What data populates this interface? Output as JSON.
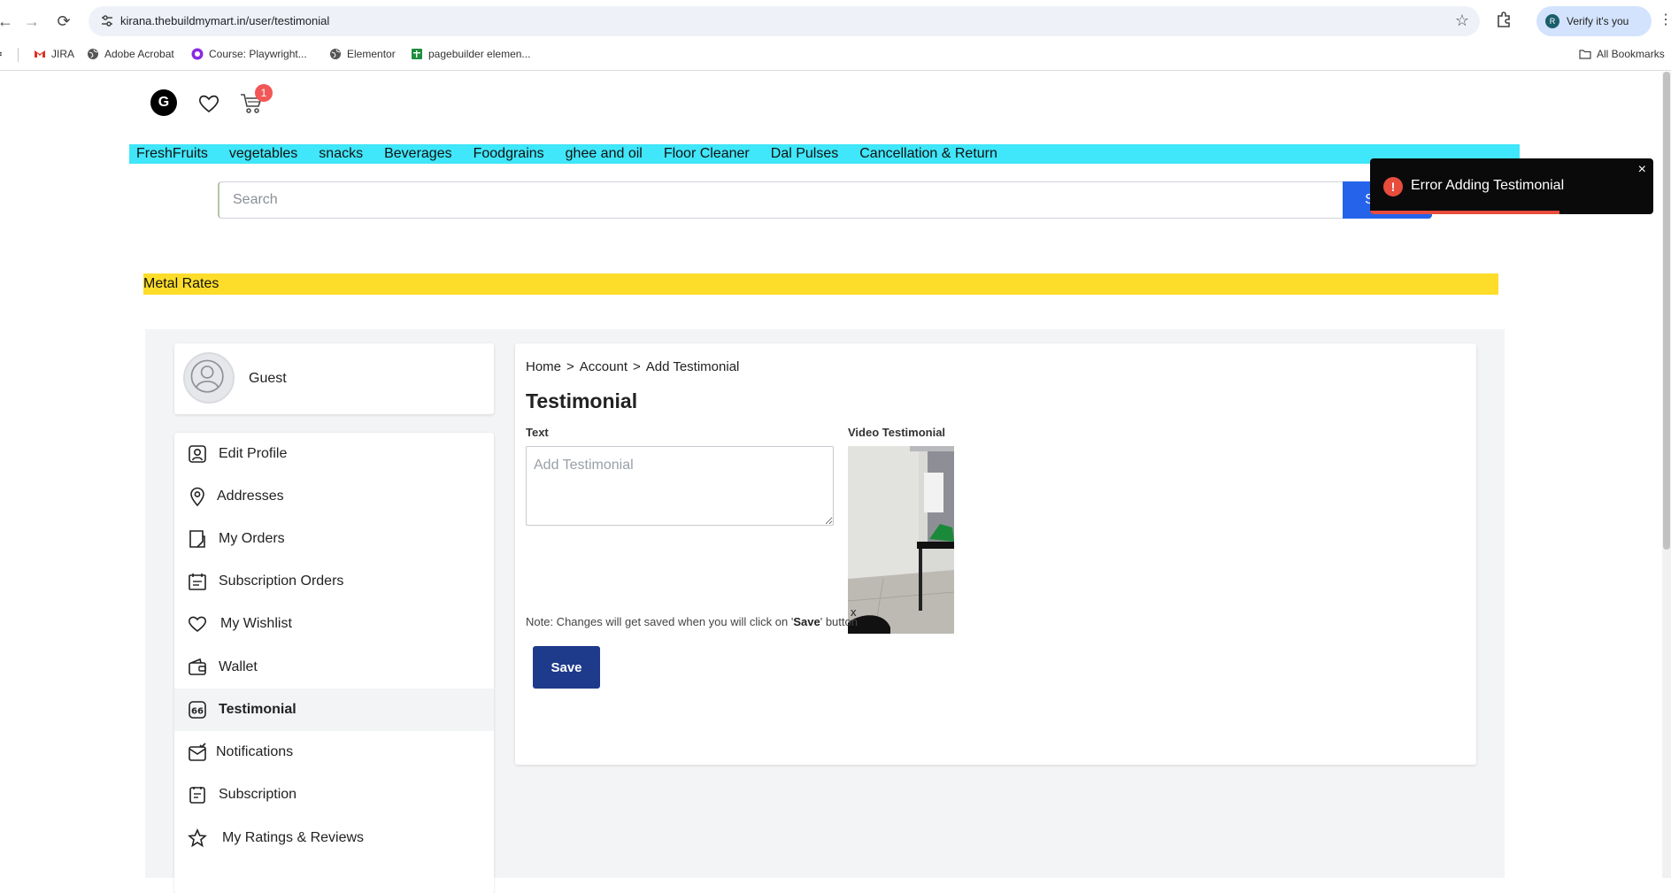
{
  "browser": {
    "url": "kirana.thebuildmymart.in/user/testimonial",
    "profile_label": "Verify it's you",
    "profile_initial": "R",
    "bookmarks": [
      "JIRA",
      "Adobe Acrobat",
      "Course: Playwright...",
      "Elementor",
      "pagebuilder elemen..."
    ],
    "all_bookmarks": "All Bookmarks"
  },
  "header": {
    "logo_letter": "G",
    "cart_count": "1"
  },
  "categories": [
    "FreshFruits",
    "vegetables",
    "snacks",
    "Beverages",
    "Foodgrains",
    "ghee and oil",
    "Floor Cleaner",
    "Dal Pulses",
    "Cancellation & Return"
  ],
  "search": {
    "placeholder": "Search",
    "button_label": "Search"
  },
  "metal_rates": "Metal Rates",
  "sidebar": {
    "user_name": "Guest",
    "items": [
      {
        "label": "Edit Profile",
        "icon": "user-square-icon"
      },
      {
        "label": "Addresses",
        "icon": "location-pin-icon"
      },
      {
        "label": "My Orders",
        "icon": "orders-icon"
      },
      {
        "label": "Subscription Orders",
        "icon": "calendar-icon"
      },
      {
        "label": "My Wishlist",
        "icon": "heart-icon"
      },
      {
        "label": "Wallet",
        "icon": "wallet-icon"
      },
      {
        "label": "Testimonial",
        "icon": "quote-icon"
      },
      {
        "label": "Notifications",
        "icon": "mail-check-icon"
      },
      {
        "label": "Subscription",
        "icon": "receipt-icon"
      },
      {
        "label": "My Ratings & Reviews",
        "icon": "star-icon"
      }
    ],
    "active_index": 6
  },
  "main": {
    "breadcrumb": [
      "Home",
      "Account",
      "Add Testimonial"
    ],
    "breadcrumb_sep": ">",
    "title": "Testimonial",
    "text_label": "Text",
    "text_placeholder": "Add Testimonial",
    "video_label": "Video Testimonial",
    "remove_label": "x",
    "note_prefix": "Note: Changes will get saved when you will click on '",
    "note_bold": "Save",
    "note_suffix": "' button",
    "save_label": "Save"
  },
  "toast": {
    "message": "Error Adding Testimonial",
    "close": "×",
    "progress": 0.67,
    "color": "#e74c3c"
  },
  "colors": {
    "category_bar": "#40e6f9",
    "metal_bar": "#fddd2a",
    "search_button": "#2563eb",
    "save_button": "#1e3a8a"
  }
}
